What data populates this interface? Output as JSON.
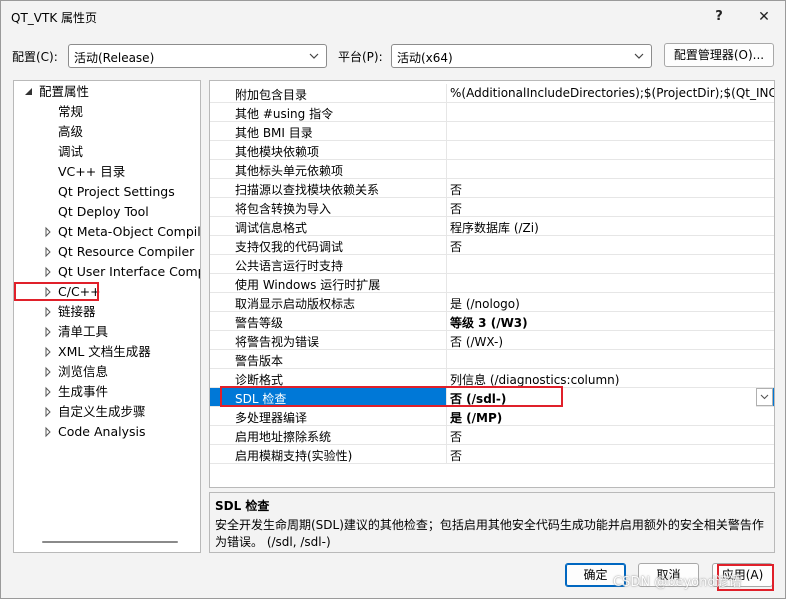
{
  "window": {
    "title": "QT_VTK 属性页",
    "help": "?",
    "close": "✕"
  },
  "config": {
    "config_label": "配置(C):",
    "config_value": "活动(Release)",
    "platform_label": "平台(P):",
    "platform_value": "活动(x64)",
    "manager_button": "配置管理器(O)..."
  },
  "tree": {
    "root": "配置属性",
    "items": [
      {
        "label": "常规",
        "expandable": false
      },
      {
        "label": "高级",
        "expandable": false
      },
      {
        "label": "调试",
        "expandable": false
      },
      {
        "label": "VC++ 目录",
        "expandable": false
      },
      {
        "label": "Qt Project Settings",
        "expandable": false
      },
      {
        "label": "Qt Deploy Tool",
        "expandable": false
      },
      {
        "label": "Qt Meta-Object Compiler",
        "expandable": true
      },
      {
        "label": "Qt Resource Compiler",
        "expandable": true
      },
      {
        "label": "Qt User Interface Compiler",
        "expandable": true
      },
      {
        "label": "C/C++",
        "expandable": true
      },
      {
        "label": "链接器",
        "expandable": true
      },
      {
        "label": "清单工具",
        "expandable": true
      },
      {
        "label": "XML 文档生成器",
        "expandable": true
      },
      {
        "label": "浏览信息",
        "expandable": true
      },
      {
        "label": "生成事件",
        "expandable": true
      },
      {
        "label": "自定义生成步骤",
        "expandable": true
      },
      {
        "label": "Code Analysis",
        "expandable": true
      }
    ]
  },
  "grid": {
    "rows": [
      {
        "k": "附加包含目录",
        "v": "%(AdditionalIncludeDirectories);$(ProjectDir);$(Qt_INCLU"
      },
      {
        "k": "其他 #using 指令",
        "v": ""
      },
      {
        "k": "其他 BMI 目录",
        "v": ""
      },
      {
        "k": "其他模块依赖项",
        "v": ""
      },
      {
        "k": "其他标头单元依赖项",
        "v": ""
      },
      {
        "k": "扫描源以查找模块依赖关系",
        "v": "否"
      },
      {
        "k": "将包含转换为导入",
        "v": "否"
      },
      {
        "k": "调试信息格式",
        "v": "程序数据库 (/Zi)"
      },
      {
        "k": "支持仅我的代码调试",
        "v": "否"
      },
      {
        "k": "公共语言运行时支持",
        "v": ""
      },
      {
        "k": "使用 Windows 运行时扩展",
        "v": ""
      },
      {
        "k": "取消显示启动版权标志",
        "v": "是 (/nologo)"
      },
      {
        "k": "警告等级",
        "v": "等级 3 (/W3)",
        "bold": true
      },
      {
        "k": "将警告视为错误",
        "v": "否 (/WX-)"
      },
      {
        "k": "警告版本",
        "v": ""
      },
      {
        "k": "诊断格式",
        "v": "列信息 (/diagnostics:column)"
      },
      {
        "k": "SDL 检查",
        "v": "否 (/sdl-)",
        "selected": true
      },
      {
        "k": "多处理器编译",
        "v": "是 (/MP)",
        "bold": true
      },
      {
        "k": "启用地址擦除系统",
        "v": "否"
      },
      {
        "k": "启用模糊支持(实验性)",
        "v": "否"
      }
    ]
  },
  "description": {
    "title": "SDL 检查",
    "body": "安全开发生命周期(SDL)建议的其他检查；包括启用其他安全代码生成功能并启用额外的安全相关警告作为错误。    (/sdl, /sdl-)"
  },
  "buttons": {
    "ok": "确定",
    "cancel": "取消",
    "apply": "应用(A)"
  },
  "watermark": "CSDN @beyond谚语",
  "colors": {
    "selection": "#0078d7",
    "highlight": "#e0202a"
  }
}
